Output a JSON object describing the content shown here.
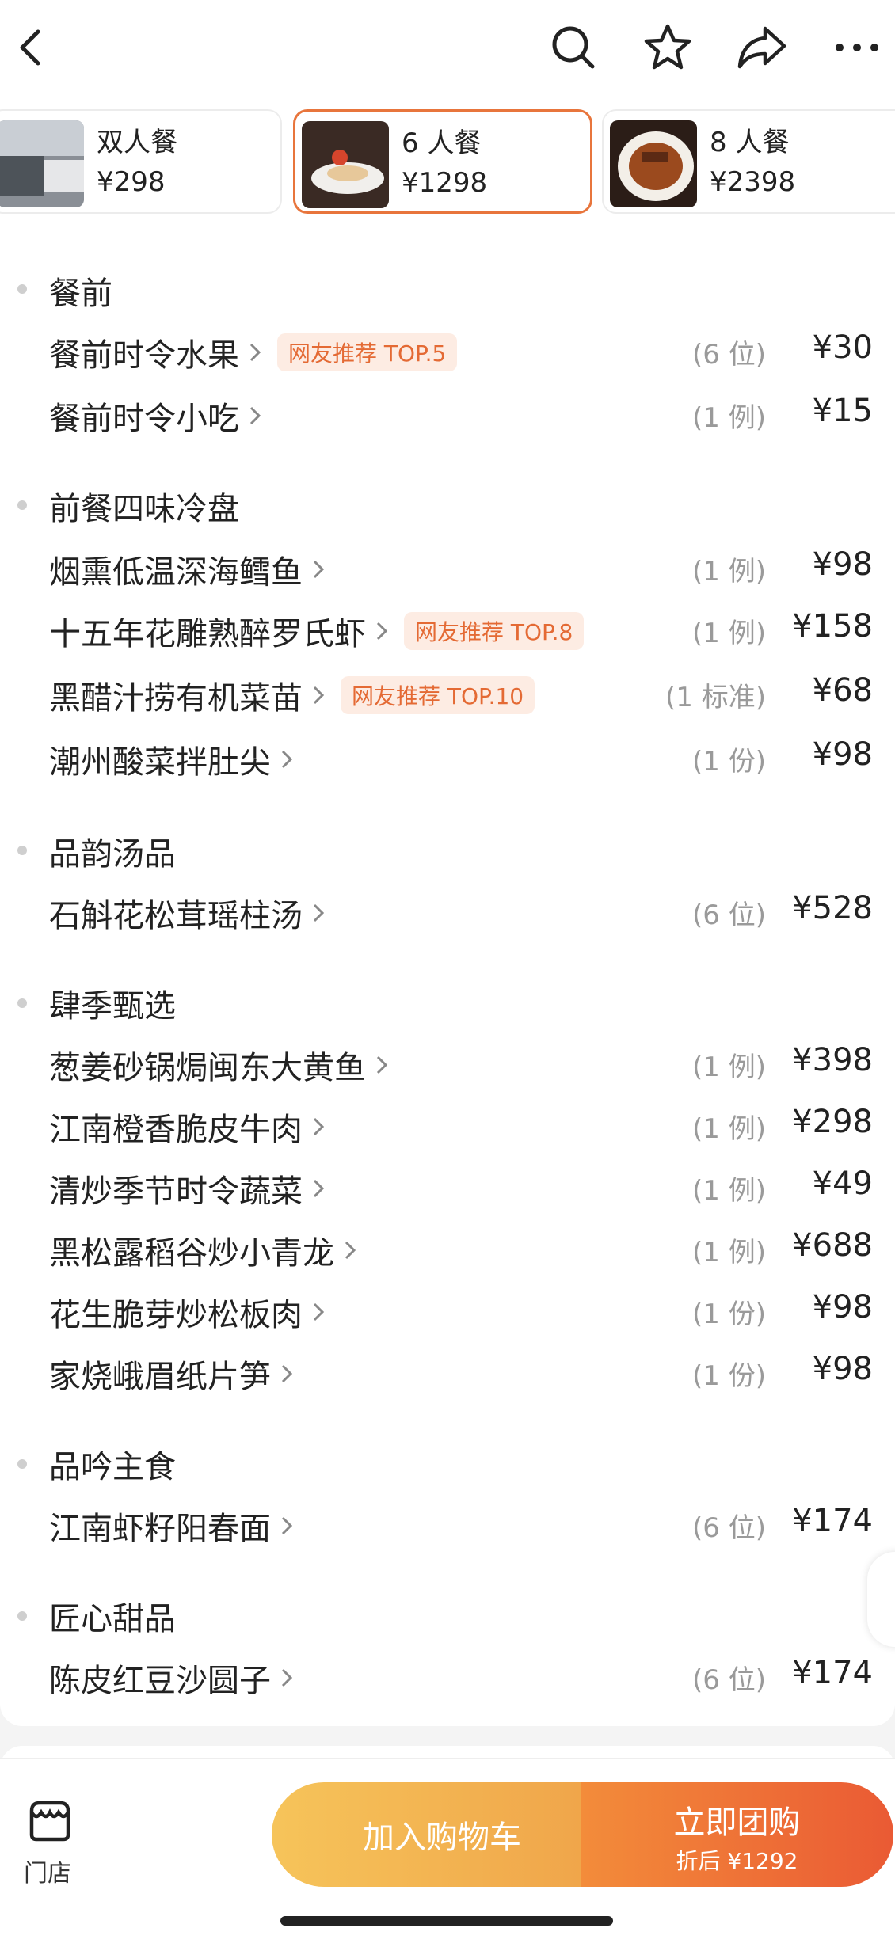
{
  "header": {
    "icons": [
      "back-arrow-icon",
      "search-icon",
      "star-icon",
      "share-icon",
      "more-icon"
    ]
  },
  "packages": [
    {
      "name": "双人餐",
      "price": "¥298",
      "selected": false
    },
    {
      "name": "6 人餐",
      "price": "¥1298",
      "selected": true
    },
    {
      "name": "8 人餐",
      "price": "¥2398",
      "selected": false
    }
  ],
  "menu": {
    "sections": [
      {
        "title": "餐前",
        "items": [
          {
            "name": "餐前时令水果",
            "tag": "网友推荐 TOP.5",
            "qty": "(6 位)",
            "price": "¥30"
          },
          {
            "name": "餐前时令小吃",
            "tag": "",
            "qty": "(1 例)",
            "price": "¥15"
          }
        ]
      },
      {
        "title": "前餐四味冷盘",
        "items": [
          {
            "name": "烟熏低温深海鳕鱼",
            "tag": "",
            "qty": "(1 例)",
            "price": "¥98"
          },
          {
            "name": "十五年花雕熟醉罗氏虾",
            "tag": "网友推荐 TOP.8",
            "qty": "(1 例)",
            "price": "¥158"
          },
          {
            "name": "黑醋汁捞有机菜苗",
            "tag": "网友推荐 TOP.10",
            "qty": "(1 标准)",
            "price": "¥68"
          },
          {
            "name": "潮州酸菜拌肚尖",
            "tag": "",
            "qty": "(1 份)",
            "price": "¥98"
          }
        ]
      },
      {
        "title": "品韵汤品",
        "items": [
          {
            "name": "石斛花松茸瑶柱汤",
            "tag": "",
            "qty": "(6 位)",
            "price": "¥528"
          }
        ]
      },
      {
        "title": "肆季甄选",
        "items": [
          {
            "name": "葱姜砂锅焗闽东大黄鱼",
            "tag": "",
            "qty": "(1 例)",
            "price": "¥398"
          },
          {
            "name": "江南橙香脆皮牛肉",
            "tag": "",
            "qty": "(1 例)",
            "price": "¥298"
          },
          {
            "name": "清炒季节时令蔬菜",
            "tag": "",
            "qty": "(1 例)",
            "price": "¥49"
          },
          {
            "name": "黑松露稻谷炒小青龙",
            "tag": "",
            "qty": "(1 例)",
            "price": "¥688"
          },
          {
            "name": "花生脆芽炒松板肉",
            "tag": "",
            "qty": "(1 份)",
            "price": "¥98"
          },
          {
            "name": "家烧峨眉纸片笋",
            "tag": "",
            "qty": "(1 份)",
            "price": "¥98"
          }
        ]
      },
      {
        "title": "品吟主食",
        "items": [
          {
            "name": "江南虾籽阳春面",
            "tag": "",
            "qty": "(6 位)",
            "price": "¥174"
          }
        ]
      },
      {
        "title": "匠心甜品",
        "items": [
          {
            "name": "陈皮红豆沙圆子",
            "tag": "",
            "qty": "(6 位)",
            "price": "¥174"
          }
        ]
      }
    ]
  },
  "bottom": {
    "store_label": "门店",
    "store_icon": "store-icon",
    "cart_label": "加入购物车",
    "buy_label": "立即团购",
    "buy_sub": "折后 ¥1292",
    "cart_gradient": [
      "#f6c45a",
      "#f0a54a"
    ],
    "buy_gradient": [
      "#f38c3a",
      "#ea5a34"
    ]
  },
  "colors": {
    "accent": "#e8753c",
    "tag_bg": "#fdece3",
    "tag_text": "#e46a34"
  }
}
